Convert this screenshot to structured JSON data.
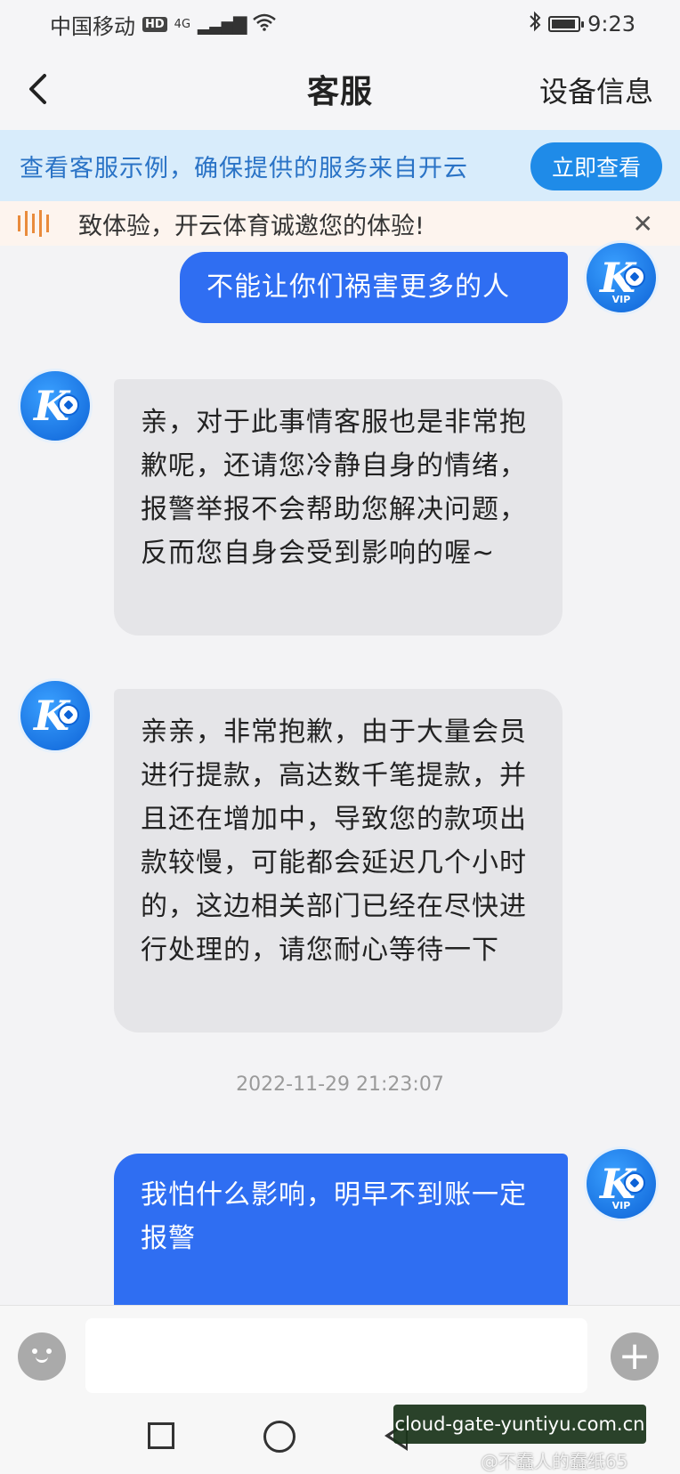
{
  "status_bar": {
    "carrier": "中国移动",
    "hd": "HD",
    "network": "4G",
    "time": "9:23"
  },
  "header": {
    "title": "客服",
    "device_info": "设备信息"
  },
  "banner": {
    "text": "查看客服示例，确保提供的服务来自开云",
    "button": "立即查看"
  },
  "marquee": {
    "text": "致体验，开云体育诚邀您的体验!"
  },
  "messages": [
    {
      "sender": "user",
      "text": "不能让你们祸害更多的人"
    },
    {
      "sender": "agent",
      "text": "亲，对于此事情客服也是非常抱歉呢，还请您冷静自身的情绪，报警举报不会帮助您解决问题，反而您自身会受到影响的喔~"
    },
    {
      "sender": "agent",
      "text": "亲亲，非常抱歉，由于大量会员进行提款，高达数千笔提款，并且还在增加中，导致您的款项出款较慢，可能都会延迟几个小时的，这边相关部门已经在尽快进行处理的，请您耐心等待一下"
    },
    {
      "sender": "user",
      "text": "我怕什么影响，明早不到账一定报警"
    }
  ],
  "timestamp": "2022-11-29 21:23:07",
  "avatar": {
    "vip_label": "VIP"
  },
  "input": {
    "placeholder": "",
    "value": ""
  },
  "watermark": {
    "domain": "cloud-gate-yuntiyu.com.cn",
    "author": "@不蠢人的蠢纸65"
  },
  "icons": {
    "back": "chevron-left-icon",
    "close": "close-icon",
    "emoji": "emoji-icon",
    "add": "plus-icon",
    "marquee": "sound-bars-icon"
  },
  "colors": {
    "user_bubble": "#2f6ef2",
    "agent_bubble": "#e5e5e8",
    "banner_bg": "#d8ecfb",
    "accent": "#1f8be8"
  }
}
